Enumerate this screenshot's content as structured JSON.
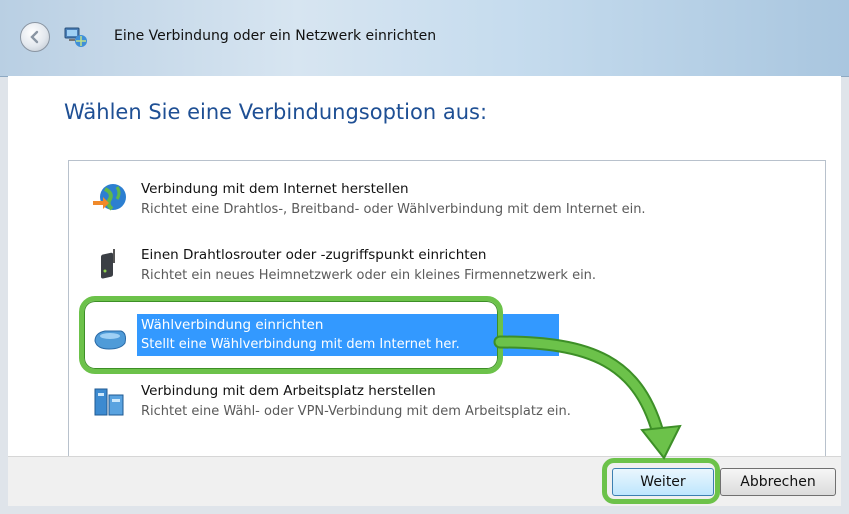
{
  "window": {
    "title": "Eine Verbindung oder ein Netzwerk einrichten",
    "back_icon": "back-arrow-icon",
    "app_icon": "network-setup-icon"
  },
  "heading": "Wählen Sie eine Verbindungsoption aus:",
  "options": [
    {
      "title": "Verbindung mit dem Internet herstellen",
      "description": "Richtet eine Drahtlos-, Breitband- oder Wählverbindung mit dem Internet ein.",
      "icon": "globe-connect-icon",
      "selected": false
    },
    {
      "title": "Einen Drahtlosrouter oder -zugriffspunkt einrichten",
      "description": "Richtet ein neues Heimnetzwerk oder ein kleines Firmennetzwerk ein.",
      "icon": "wireless-router-icon",
      "selected": false
    },
    {
      "title": "Wählverbindung einrichten",
      "description": "Stellt eine Wählverbindung mit dem Internet her.",
      "icon": "dialup-modem-icon",
      "selected": true
    },
    {
      "title": "Verbindung mit dem Arbeitsplatz herstellen",
      "description": "Richtet eine Wähl- oder VPN-Verbindung mit dem Arbeitsplatz ein.",
      "icon": "workplace-vpn-icon",
      "selected": false
    }
  ],
  "buttons": {
    "next": "Weiter",
    "cancel": "Abbrechen"
  },
  "colors": {
    "selection": "#3399ff",
    "annotation_green": "#6cc24a",
    "heading_blue": "#1e4f94"
  }
}
